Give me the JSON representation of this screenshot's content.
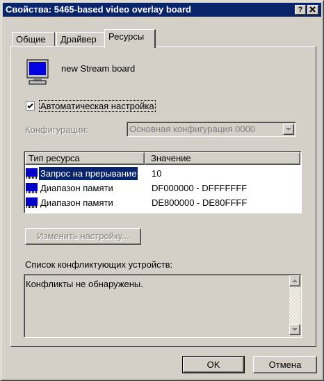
{
  "window": {
    "title": "Свойства: 5465-based video overlay board",
    "help_button": "?",
    "close_button": "X"
  },
  "tabs": [
    {
      "label": "Общие"
    },
    {
      "label": "Драйвер"
    },
    {
      "label": "Ресурсы"
    }
  ],
  "device": {
    "name": "new Stream board",
    "icon": "monitor-icon"
  },
  "auto_config": {
    "label": "Автоматическая настройка",
    "checked": true
  },
  "configuration": {
    "label": "Конфигурация:",
    "value": "Основная конфигурация 0000"
  },
  "resources": {
    "columns": [
      "Тип ресурса",
      "Значение"
    ],
    "rows": [
      {
        "type": "Запрос на прерывание",
        "value": "10"
      },
      {
        "type": "Диапазон памяти",
        "value": "DF000000 - DFFFFFFF"
      },
      {
        "type": "Диапазон памяти",
        "value": "DE800000 - DE80FFFF"
      }
    ],
    "selected_row": 0
  },
  "change_settings_button": "Изменить настройку...",
  "conflicts": {
    "label": "Список конфликтующих устройств:",
    "text": "Конфликты не обнаружены."
  },
  "footer": {
    "ok": "OK",
    "cancel": "Отмена"
  },
  "colors": {
    "titlebar": "#0a246a",
    "selection": "#0a246a",
    "face": "#d4d0c8"
  }
}
